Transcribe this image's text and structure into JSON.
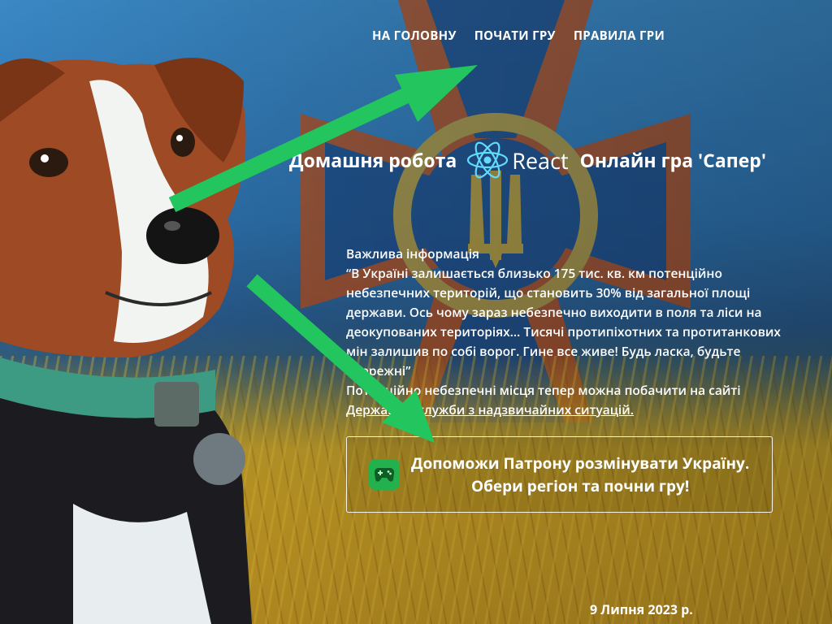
{
  "nav": {
    "home": "НА ГОЛОВНУ",
    "start": "ПОЧАТИ ГРУ",
    "rules": "ПРАВИЛА ГРИ"
  },
  "header": {
    "left_text": "Домашня робота",
    "logo_text": "React",
    "right_text": "Онлайн гра 'Сапер'"
  },
  "info": {
    "heading": "Важлива інформація",
    "quote": "“В Україні залишається близько 175 тис. кв. км потенційно небезпечних територій, що становить 30% від загальної площі держави. Ось чому зараз небезпечно виходити в поля та ліси на деокупованих територіях… Тисячі протипіхотних та протитанкових мін залишив по собі ворог. Гине все живе! Будь ласка, будьте обережні”",
    "note_prefix": "Потенційно небезпечні місця тепер можна побачити на сайті",
    "link": "Державної служби з надзвичайних ситуацій."
  },
  "cta": {
    "line1": "Допоможи Патрону розмінувати Україну.",
    "line2": "Обери регіон та почни гру!",
    "icon": "gamepad-icon"
  },
  "footer": {
    "date": "9 Липня 2023 р."
  },
  "colors": {
    "arrow": "#22c55e",
    "emblem_orange": "#c2531d",
    "emblem_blue": "#1f4f8d",
    "react_blue": "#61dafb",
    "gamepad_green": "#23b14d"
  }
}
